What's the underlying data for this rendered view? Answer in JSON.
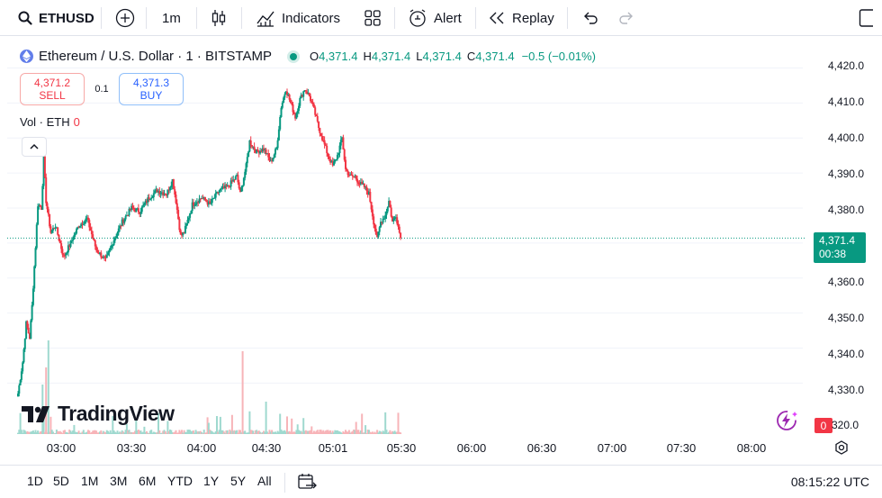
{
  "toolbar": {
    "symbol": "ETHUSD",
    "interval": "1m",
    "indicators_label": "Indicators",
    "alert_label": "Alert",
    "replay_label": "Replay"
  },
  "legend": {
    "title": "Ethereum / U.S. Dollar · 1 · BITSTAMP",
    "o_key": "O",
    "o_val": "4,371.4",
    "h_key": "H",
    "h_val": "4,371.4",
    "l_key": "L",
    "l_val": "4,371.4",
    "c_key": "C",
    "c_val": "4,371.4",
    "change": "−0.5 (−0.01%)"
  },
  "trade": {
    "sell_price": "4,371.2",
    "sell_label": "SELL",
    "spread": "0.1",
    "buy_price": "4,371.3",
    "buy_label": "BUY"
  },
  "volume": {
    "label": "Vol · ETH",
    "value": "0"
  },
  "watermark": "TradingView",
  "price_axis": [
    "4,420.0",
    "4,410.0",
    "4,400.0",
    "4,390.0",
    "4,380.0",
    "4,360.0",
    "4,350.0",
    "4,340.0",
    "4,330.0"
  ],
  "last_price": {
    "price": "4,371.4",
    "countdown": "00:38"
  },
  "volume_axis": {
    "tag": "0",
    "value": "320.0"
  },
  "time_axis": [
    "03:00",
    "03:30",
    "04:00",
    "04:30",
    "05:01",
    "05:30",
    "06:00",
    "06:30",
    "07:00",
    "07:30",
    "08:00"
  ],
  "ranges": [
    "1D",
    "5D",
    "1M",
    "3M",
    "6M",
    "YTD",
    "1Y",
    "5Y",
    "All"
  ],
  "clock": "08:15:22 UTC",
  "colors": {
    "up": "#089981",
    "down": "#f23645",
    "up_vol": "#9fd9cf",
    "down_vol": "#f7b4b8",
    "accent": "#2962ff"
  },
  "chart_data": {
    "type": "candlestick",
    "y_range": [
      4318,
      4425
    ],
    "x_start": "02:48",
    "interval_minutes": 1,
    "anchors": [
      {
        "t": "02:48",
        "price": 4327
      },
      {
        "t": "02:52",
        "price": 4336
      },
      {
        "t": "02:55",
        "price": 4347
      },
      {
        "t": "02:58",
        "price": 4343
      },
      {
        "t": "03:00",
        "price": 4352
      },
      {
        "t": "03:03",
        "price": 4369
      },
      {
        "t": "03:05",
        "price": 4381
      },
      {
        "t": "03:08",
        "price": 4380
      },
      {
        "t": "03:10",
        "price": 4394
      },
      {
        "t": "03:12",
        "price": 4382
      },
      {
        "t": "03:16",
        "price": 4373
      },
      {
        "t": "03:20",
        "price": 4375
      },
      {
        "t": "03:27",
        "price": 4366
      },
      {
        "t": "03:33",
        "price": 4370
      },
      {
        "t": "03:40",
        "price": 4375
      },
      {
        "t": "03:47",
        "price": 4377
      },
      {
        "t": "03:55",
        "price": 4368
      },
      {
        "t": "04:03",
        "price": 4365
      },
      {
        "t": "04:10",
        "price": 4371
      },
      {
        "t": "04:17",
        "price": 4376
      },
      {
        "t": "04:25",
        "price": 4380
      },
      {
        "t": "04:32",
        "price": 4379
      },
      {
        "t": "04:40",
        "price": 4383
      },
      {
        "t": "04:47",
        "price": 4385
      },
      {
        "t": "04:55",
        "price": 4384
      },
      {
        "t": "05:00",
        "price": 4388
      },
      {
        "t": "05:03",
        "price": 4382
      },
      {
        "t": "05:07",
        "price": 4372
      },
      {
        "t": "05:10",
        "price": 4373
      },
      {
        "t": "05:17",
        "price": 4381
      },
      {
        "t": "05:25",
        "price": 4383
      },
      {
        "t": "05:32",
        "price": 4381
      },
      {
        "t": "05:40",
        "price": 4385
      },
      {
        "t": "05:47",
        "price": 4386
      },
      {
        "t": "05:55",
        "price": 4389
      },
      {
        "t": "05:58",
        "price": 4384
      },
      {
        "t": "06:03",
        "price": 4392
      },
      {
        "t": "06:06",
        "price": 4399
      },
      {
        "t": "06:12",
        "price": 4396
      },
      {
        "t": "06:18",
        "price": 4397
      },
      {
        "t": "06:24",
        "price": 4393
      },
      {
        "t": "06:29",
        "price": 4397
      },
      {
        "t": "06:33",
        "price": 4409
      },
      {
        "t": "06:37",
        "price": 4414
      },
      {
        "t": "06:41",
        "price": 4410
      },
      {
        "t": "06:45",
        "price": 4406
      },
      {
        "t": "06:49",
        "price": 4411
      },
      {
        "t": "06:53",
        "price": 4414
      },
      {
        "t": "06:57",
        "price": 4412
      },
      {
        "t": "07:01",
        "price": 4408
      },
      {
        "t": "07:05",
        "price": 4403
      },
      {
        "t": "07:09",
        "price": 4399
      },
      {
        "t": "07:13",
        "price": 4395
      },
      {
        "t": "07:17",
        "price": 4392
      },
      {
        "t": "07:21",
        "price": 4395
      },
      {
        "t": "07:25",
        "price": 4400
      },
      {
        "t": "07:28",
        "price": 4391
      },
      {
        "t": "07:32",
        "price": 4389
      },
      {
        "t": "07:36",
        "price": 4389
      },
      {
        "t": "07:40",
        "price": 4387
      },
      {
        "t": "07:44",
        "price": 4386
      },
      {
        "t": "07:48",
        "price": 4384
      },
      {
        "t": "07:52",
        "price": 4376
      },
      {
        "t": "07:55",
        "price": 4371
      },
      {
        "t": "07:58",
        "price": 4376
      },
      {
        "t": "08:02",
        "price": 4378
      },
      {
        "t": "08:05",
        "price": 4382
      },
      {
        "t": "08:08",
        "price": 4376
      },
      {
        "t": "08:11",
        "price": 4378
      },
      {
        "t": "08:14",
        "price": 4373
      },
      {
        "t": "08:15",
        "price": 4371.4
      }
    ],
    "last_price": 4371.4
  }
}
